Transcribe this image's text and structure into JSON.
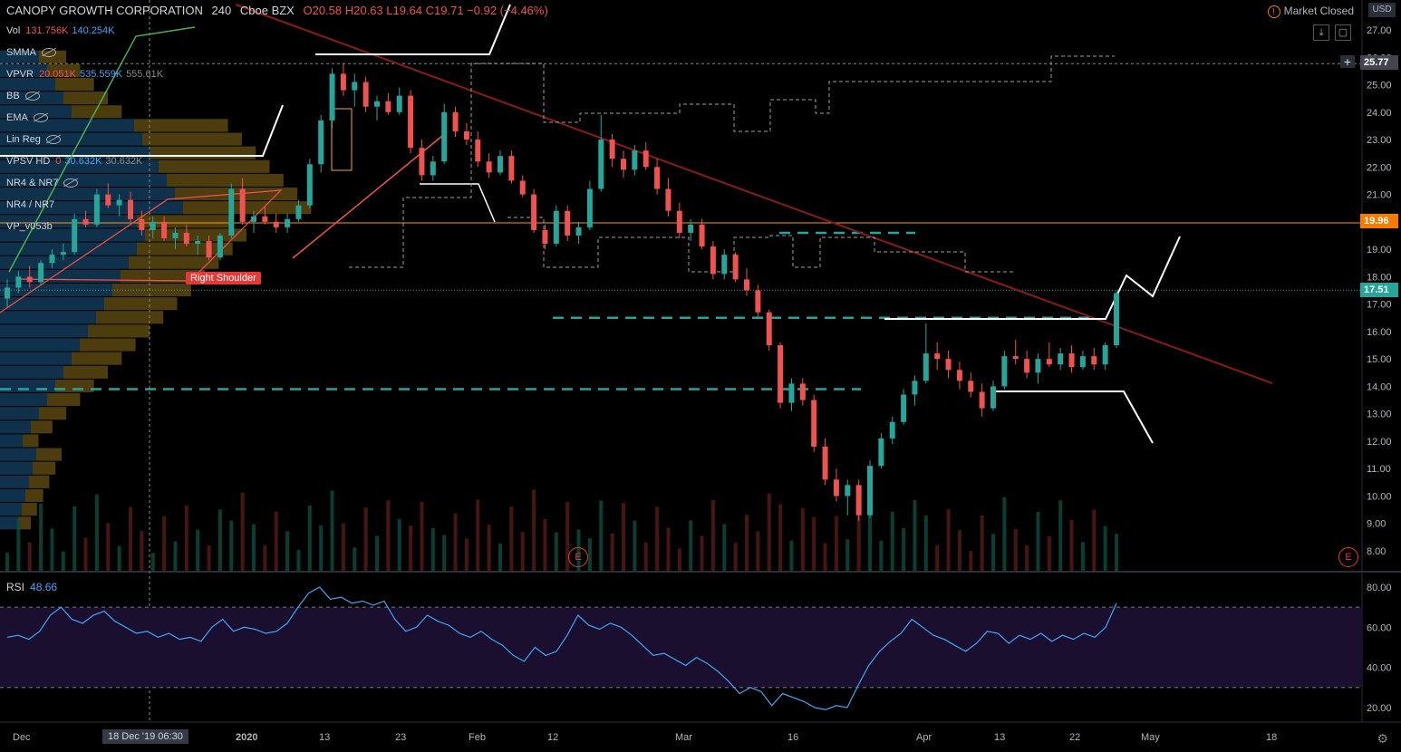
{
  "header": {
    "symbol": "CANOPY GROWTH CORPORATION",
    "interval": "240",
    "exchange": "Cboe BZX",
    "ohlc": "O20.58 H20.63 L19.64 C19.71 −0.92 (−4.46%)"
  },
  "indicators": [
    {
      "name": "Vol",
      "v1": "131.756K",
      "v2": "140.254K",
      "v3": ""
    },
    {
      "name": "SMMA",
      "v1": "",
      "v2": "",
      "v3": "",
      "hidden": true
    },
    {
      "name": "VPVR",
      "v1": "20.051K",
      "v2": "535.559K",
      "v3": "555.61K"
    },
    {
      "name": "BB",
      "v1": "",
      "v2": "",
      "v3": "",
      "hidden": true
    },
    {
      "name": "EMA",
      "v1": "",
      "v2": "",
      "v3": "",
      "hidden": true
    },
    {
      "name": "Lin Reg",
      "v1": "",
      "v2": "",
      "v3": "",
      "hidden": true
    },
    {
      "name": "VPSV HD",
      "v1": "0",
      "v2": "30.632K",
      "v3": "30.632K"
    },
    {
      "name": "NR4 & NR7",
      "v1": "",
      "v2": "",
      "v3": "",
      "hidden": true
    },
    {
      "name": "NR4 / NR7",
      "v1": "",
      "v2": "",
      "v3": ""
    },
    {
      "name": "VP_v053b",
      "v1": "",
      "v2": "",
      "v3": ""
    }
  ],
  "market_status": "Market Closed",
  "currency": "USD",
  "price_tags": {
    "p1": "25.77",
    "p2": "19.96",
    "p3": "17.51"
  },
  "annotation": "Right Shoulder",
  "rsi": {
    "label": "RSI",
    "value": "48.66"
  },
  "crosshair_label": "18 Dec '19   06:30",
  "earnings_marker": "E",
  "colors": {
    "up": "#26a69a",
    "down": "#ef5350",
    "orange": "#ff9800",
    "trend": "#8b1a1a",
    "dash": "#26a69a",
    "rsi": "#42a5f5"
  },
  "chart_data": {
    "type": "candlestick",
    "y_ticks": [
      27,
      26,
      25,
      24,
      23,
      22,
      21,
      20,
      19,
      18,
      17,
      16,
      15,
      14,
      13,
      12,
      11,
      10,
      9,
      8
    ],
    "ylim": [
      7.6,
      27.6
    ],
    "rsi_ticks": [
      80,
      60,
      40,
      20
    ],
    "rsi_levels": [
      70,
      30
    ],
    "x_labels": [
      "Dec",
      "2020",
      "13",
      "23",
      "Feb",
      "12",
      "Mar",
      "16",
      "Apr",
      "13",
      "22",
      "May",
      "18"
    ],
    "horizontal_levels": {
      "orange": 19.96,
      "dotted": 17.51
    },
    "dashed_levels": [
      16.5,
      13.9,
      19.6
    ],
    "candles": [
      {
        "o": 17.2,
        "h": 17.9,
        "l": 16.9,
        "c": 17.6
      },
      {
        "o": 17.6,
        "h": 18.2,
        "l": 17.4,
        "c": 18.0
      },
      {
        "o": 18.0,
        "h": 18.4,
        "l": 17.6,
        "c": 17.8
      },
      {
        "o": 17.8,
        "h": 18.6,
        "l": 17.7,
        "c": 18.5
      },
      {
        "o": 18.5,
        "h": 19.0,
        "l": 18.3,
        "c": 18.8
      },
      {
        "o": 18.8,
        "h": 19.2,
        "l": 18.6,
        "c": 18.9
      },
      {
        "o": 18.9,
        "h": 20.3,
        "l": 18.8,
        "c": 20.1
      },
      {
        "o": 20.1,
        "h": 20.4,
        "l": 19.8,
        "c": 19.9
      },
      {
        "o": 19.9,
        "h": 21.2,
        "l": 19.8,
        "c": 21.0
      },
      {
        "o": 21.0,
        "h": 21.4,
        "l": 20.5,
        "c": 20.6
      },
      {
        "o": 20.6,
        "h": 21.0,
        "l": 20.2,
        "c": 20.8
      },
      {
        "o": 20.8,
        "h": 21.1,
        "l": 20.0,
        "c": 20.1
      },
      {
        "o": 20.1,
        "h": 20.4,
        "l": 19.5,
        "c": 19.7
      },
      {
        "o": 19.7,
        "h": 20.2,
        "l": 19.4,
        "c": 20.0
      },
      {
        "o": 20.0,
        "h": 20.2,
        "l": 19.3,
        "c": 19.4
      },
      {
        "o": 19.4,
        "h": 19.8,
        "l": 19.0,
        "c": 19.6
      },
      {
        "o": 19.6,
        "h": 19.9,
        "l": 19.1,
        "c": 19.2
      },
      {
        "o": 19.2,
        "h": 19.5,
        "l": 18.8,
        "c": 19.3
      },
      {
        "o": 19.3,
        "h": 19.5,
        "l": 18.6,
        "c": 18.7
      },
      {
        "o": 18.7,
        "h": 19.6,
        "l": 18.6,
        "c": 19.5
      },
      {
        "o": 19.5,
        "h": 21.4,
        "l": 19.4,
        "c": 21.2
      },
      {
        "o": 21.2,
        "h": 21.6,
        "l": 19.9,
        "c": 20.0
      },
      {
        "o": 20.0,
        "h": 20.4,
        "l": 19.6,
        "c": 20.2
      },
      {
        "o": 20.2,
        "h": 20.6,
        "l": 19.9,
        "c": 20.0
      },
      {
        "o": 20.0,
        "h": 20.3,
        "l": 19.6,
        "c": 19.8
      },
      {
        "o": 19.8,
        "h": 20.3,
        "l": 19.6,
        "c": 20.1
      },
      {
        "o": 20.1,
        "h": 20.8,
        "l": 20.0,
        "c": 20.6
      },
      {
        "o": 20.6,
        "h": 22.3,
        "l": 20.5,
        "c": 22.1
      },
      {
        "o": 22.1,
        "h": 23.9,
        "l": 21.8,
        "c": 23.7
      },
      {
        "o": 23.7,
        "h": 25.6,
        "l": 23.4,
        "c": 25.4
      },
      {
        "o": 25.4,
        "h": 25.8,
        "l": 24.6,
        "c": 24.8
      },
      {
        "o": 24.8,
        "h": 25.4,
        "l": 24.2,
        "c": 25.1
      },
      {
        "o": 25.1,
        "h": 25.3,
        "l": 24.0,
        "c": 24.2
      },
      {
        "o": 24.2,
        "h": 24.6,
        "l": 23.7,
        "c": 24.4
      },
      {
        "o": 24.4,
        "h": 24.7,
        "l": 23.9,
        "c": 24.0
      },
      {
        "o": 24.0,
        "h": 24.9,
        "l": 23.9,
        "c": 24.6
      },
      {
        "o": 24.6,
        "h": 24.8,
        "l": 22.5,
        "c": 22.7
      },
      {
        "o": 22.7,
        "h": 23.0,
        "l": 21.5,
        "c": 21.7
      },
      {
        "o": 21.7,
        "h": 22.4,
        "l": 21.5,
        "c": 22.2
      },
      {
        "o": 22.2,
        "h": 24.3,
        "l": 22.1,
        "c": 24.0
      },
      {
        "o": 24.0,
        "h": 24.2,
        "l": 23.1,
        "c": 23.3
      },
      {
        "o": 23.3,
        "h": 23.6,
        "l": 22.8,
        "c": 23.0
      },
      {
        "o": 23.0,
        "h": 23.3,
        "l": 22.0,
        "c": 22.2
      },
      {
        "o": 22.2,
        "h": 22.5,
        "l": 21.6,
        "c": 21.8
      },
      {
        "o": 21.8,
        "h": 22.6,
        "l": 21.7,
        "c": 22.4
      },
      {
        "o": 22.4,
        "h": 22.6,
        "l": 21.4,
        "c": 21.5
      },
      {
        "o": 21.5,
        "h": 21.7,
        "l": 20.9,
        "c": 21.0
      },
      {
        "o": 21.0,
        "h": 21.2,
        "l": 19.6,
        "c": 19.7
      },
      {
        "o": 19.7,
        "h": 19.9,
        "l": 19.0,
        "c": 19.2
      },
      {
        "o": 19.2,
        "h": 20.6,
        "l": 19.1,
        "c": 20.4
      },
      {
        "o": 20.4,
        "h": 20.6,
        "l": 19.3,
        "c": 19.5
      },
      {
        "o": 19.5,
        "h": 20.0,
        "l": 19.2,
        "c": 19.8
      },
      {
        "o": 19.8,
        "h": 21.5,
        "l": 19.7,
        "c": 21.2
      },
      {
        "o": 21.2,
        "h": 23.9,
        "l": 21.1,
        "c": 23.0
      },
      {
        "o": 23.0,
        "h": 23.2,
        "l": 22.0,
        "c": 22.3
      },
      {
        "o": 22.3,
        "h": 22.6,
        "l": 21.6,
        "c": 21.9
      },
      {
        "o": 21.9,
        "h": 22.8,
        "l": 21.7,
        "c": 22.6
      },
      {
        "o": 22.6,
        "h": 22.9,
        "l": 21.9,
        "c": 22.0
      },
      {
        "o": 22.0,
        "h": 22.3,
        "l": 21.0,
        "c": 21.2
      },
      {
        "o": 21.2,
        "h": 21.6,
        "l": 20.2,
        "c": 20.4
      },
      {
        "o": 20.4,
        "h": 20.7,
        "l": 19.4,
        "c": 19.6
      },
      {
        "o": 19.6,
        "h": 20.1,
        "l": 19.3,
        "c": 19.9
      },
      {
        "o": 19.9,
        "h": 20.1,
        "l": 19.0,
        "c": 19.1
      },
      {
        "o": 19.1,
        "h": 19.3,
        "l": 17.9,
        "c": 18.1
      },
      {
        "o": 18.1,
        "h": 19.0,
        "l": 17.9,
        "c": 18.8
      },
      {
        "o": 18.8,
        "h": 18.9,
        "l": 17.8,
        "c": 17.9
      },
      {
        "o": 17.9,
        "h": 18.3,
        "l": 17.3,
        "c": 17.5
      },
      {
        "o": 17.5,
        "h": 17.7,
        "l": 16.5,
        "c": 16.7
      },
      {
        "o": 16.7,
        "h": 16.8,
        "l": 15.3,
        "c": 15.5
      },
      {
        "o": 15.5,
        "h": 15.6,
        "l": 13.2,
        "c": 13.4
      },
      {
        "o": 13.4,
        "h": 14.3,
        "l": 13.1,
        "c": 14.1
      },
      {
        "o": 14.1,
        "h": 14.3,
        "l": 13.3,
        "c": 13.5
      },
      {
        "o": 13.5,
        "h": 13.7,
        "l": 11.6,
        "c": 11.8
      },
      {
        "o": 11.8,
        "h": 12.1,
        "l": 10.4,
        "c": 10.6
      },
      {
        "o": 10.6,
        "h": 11.0,
        "l": 9.8,
        "c": 10.0
      },
      {
        "o": 10.0,
        "h": 10.6,
        "l": 9.3,
        "c": 10.4
      },
      {
        "o": 10.4,
        "h": 10.6,
        "l": 9.1,
        "c": 9.3
      },
      {
        "o": 9.3,
        "h": 11.3,
        "l": 9.2,
        "c": 11.1
      },
      {
        "o": 11.1,
        "h": 12.3,
        "l": 11.0,
        "c": 12.1
      },
      {
        "o": 12.1,
        "h": 12.9,
        "l": 11.9,
        "c": 12.7
      },
      {
        "o": 12.7,
        "h": 13.9,
        "l": 12.6,
        "c": 13.7
      },
      {
        "o": 13.7,
        "h": 14.4,
        "l": 13.3,
        "c": 14.2
      },
      {
        "o": 14.2,
        "h": 16.3,
        "l": 14.1,
        "c": 15.2
      },
      {
        "o": 15.2,
        "h": 15.6,
        "l": 14.6,
        "c": 15.0
      },
      {
        "o": 15.0,
        "h": 15.3,
        "l": 14.3,
        "c": 14.6
      },
      {
        "o": 14.6,
        "h": 14.9,
        "l": 13.9,
        "c": 14.2
      },
      {
        "o": 14.2,
        "h": 14.5,
        "l": 13.6,
        "c": 13.8
      },
      {
        "o": 13.8,
        "h": 14.1,
        "l": 12.9,
        "c": 13.2
      },
      {
        "o": 13.2,
        "h": 14.2,
        "l": 13.1,
        "c": 14.0
      },
      {
        "o": 14.0,
        "h": 15.3,
        "l": 13.9,
        "c": 15.1
      },
      {
        "o": 15.1,
        "h": 15.7,
        "l": 14.8,
        "c": 15.0
      },
      {
        "o": 15.0,
        "h": 15.3,
        "l": 14.3,
        "c": 14.5
      },
      {
        "o": 14.5,
        "h": 15.2,
        "l": 14.1,
        "c": 15.0
      },
      {
        "o": 15.0,
        "h": 15.6,
        "l": 14.7,
        "c": 14.8
      },
      {
        "o": 14.8,
        "h": 15.4,
        "l": 14.6,
        "c": 15.2
      },
      {
        "o": 15.2,
        "h": 15.5,
        "l": 14.5,
        "c": 14.7
      },
      {
        "o": 14.7,
        "h": 15.3,
        "l": 14.6,
        "c": 15.1
      },
      {
        "o": 15.1,
        "h": 15.4,
        "l": 14.6,
        "c": 14.8
      },
      {
        "o": 14.8,
        "h": 15.6,
        "l": 14.6,
        "c": 15.5
      },
      {
        "o": 15.5,
        "h": 17.5,
        "l": 15.4,
        "c": 17.4
      }
    ],
    "rsi_values": [
      55,
      56,
      54,
      58,
      66,
      70,
      64,
      62,
      66,
      68,
      63,
      60,
      57,
      58,
      55,
      57,
      54,
      55,
      53,
      60,
      64,
      58,
      60,
      59,
      57,
      58,
      62,
      70,
      77,
      80,
      74,
      75,
      72,
      73,
      71,
      73,
      64,
      58,
      60,
      66,
      63,
      61,
      57,
      55,
      58,
      54,
      51,
      46,
      43,
      50,
      46,
      48,
      56,
      66,
      61,
      59,
      62,
      60,
      56,
      51,
      46,
      47,
      44,
      41,
      45,
      42,
      38,
      33,
      27,
      30,
      28,
      21,
      27,
      25,
      23,
      20,
      19,
      21,
      20,
      31,
      41,
      48,
      53,
      57,
      64,
      60,
      56,
      54,
      51,
      48,
      52,
      58,
      57,
      52,
      56,
      54,
      57,
      53,
      56,
      54,
      57,
      55,
      60,
      72
    ]
  }
}
